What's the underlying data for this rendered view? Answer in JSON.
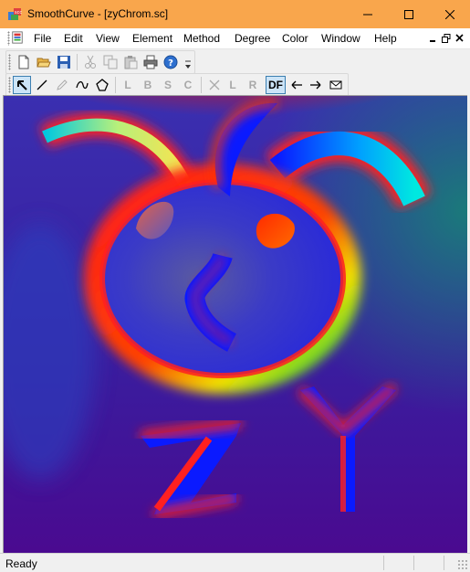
{
  "window": {
    "title": "SmoothCurve - [zyChrom.sc]",
    "titlebar_color": "#f9a64c"
  },
  "menu": {
    "items": [
      "File",
      "Edit",
      "View",
      "Element",
      "Method",
      "Degree",
      "Color",
      "Window",
      "Help"
    ]
  },
  "toolbar_standard": {
    "buttons": [
      "new-icon",
      "open-folder-icon",
      "save-icon",
      "cut-icon",
      "copy-icon",
      "paste-icon",
      "print-icon",
      "help-icon"
    ]
  },
  "toolbar_draw": {
    "letters": {
      "l": "L",
      "b": "B",
      "s": "S",
      "c": "C",
      "l2": "L",
      "r": "R",
      "df": "DF"
    },
    "icons": [
      "select-arrow-icon",
      "line-tool-icon",
      "pencil-icon",
      "curve-tool-icon",
      "polygon-tool-icon",
      "delete-cross-icon",
      "arrow-left-icon",
      "arrow-right-icon",
      "envelope-icon"
    ],
    "active_tools": [
      "select-arrow",
      "DF"
    ]
  },
  "status": {
    "text": "Ready"
  },
  "colors": {
    "accent_selected": "#cce4f7",
    "canvas_background": "#4b0fa8"
  }
}
